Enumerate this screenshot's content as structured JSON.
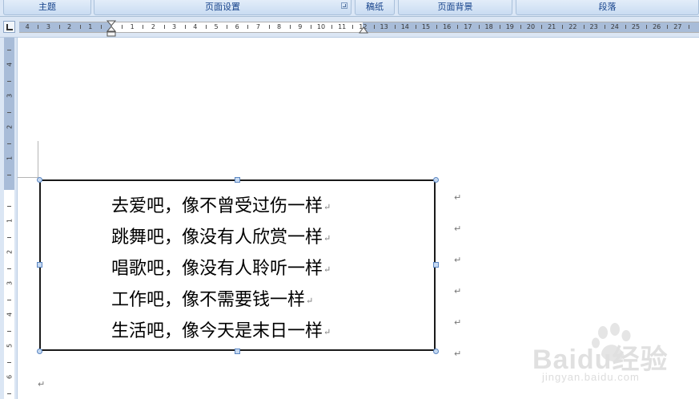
{
  "ribbon": {
    "groups": [
      {
        "label": "主题"
      },
      {
        "label": "页面设置"
      },
      {
        "label": "稿纸"
      },
      {
        "label": "页面背景"
      },
      {
        "label": "段落"
      }
    ]
  },
  "ruler": {
    "h_left_numbers": [
      "4",
      "3",
      "2",
      "1"
    ],
    "h_numbers": [
      "1",
      "2",
      "3",
      "4",
      "5",
      "6",
      "7",
      "8",
      "9",
      "10",
      "11",
      "12",
      "13",
      "14",
      "15",
      "16",
      "17",
      "18",
      "19",
      "20",
      "21",
      "22",
      "23",
      "24",
      "25",
      "26",
      "27"
    ],
    "v_top_numbers": [
      "4",
      "3",
      "2",
      "1"
    ],
    "v_numbers": [
      "1",
      "2",
      "3",
      "4",
      "5",
      "6"
    ]
  },
  "document": {
    "lines": [
      "去爱吧，像不曾受过伤一样",
      "跳舞吧，像没有人欣赏一样",
      "唱歌吧，像没有人聆听一样",
      "工作吧，像不需要钱一样",
      "生活吧，像今天是末日一样"
    ],
    "paragraph_mark": "↵"
  },
  "watermark": {
    "brand": "Baidu经验",
    "url": "jingyan.baidu.com"
  },
  "colors": {
    "ribbon_bg": "#dbe7f6",
    "ruler_margin": "#a8bcd8",
    "ribbon_text": "#15428b"
  }
}
